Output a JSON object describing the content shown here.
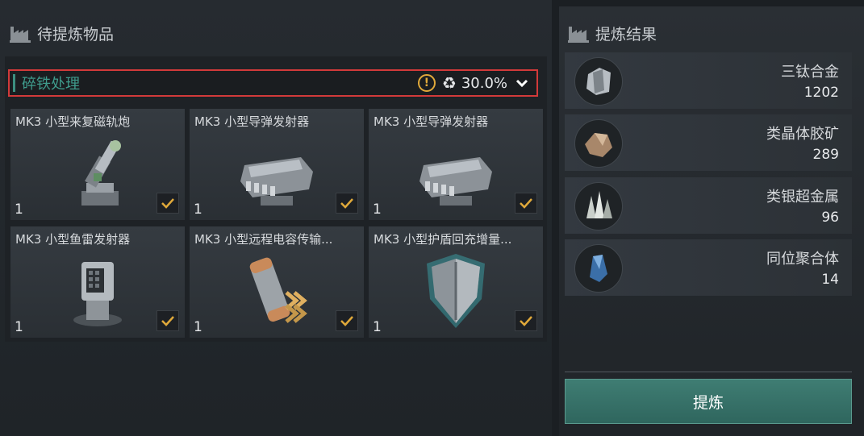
{
  "left_panel": {
    "title": "待提炼物品"
  },
  "right_panel": {
    "title": "提炼结果"
  },
  "filter": {
    "label": "碎铁处理",
    "percent": "30.0%"
  },
  "items": [
    {
      "name": "MK3 小型来复磁轨炮",
      "count": "1",
      "icon": "railgun-turret-icon"
    },
    {
      "name": "MK3 小型导弹发射器",
      "count": "1",
      "icon": "missile-launcher-icon"
    },
    {
      "name": "MK3 小型导弹发射器",
      "count": "1",
      "icon": "missile-launcher-icon"
    },
    {
      "name": "MK3 小型鱼雷发射器",
      "count": "1",
      "icon": "torpedo-launcher-icon"
    },
    {
      "name": "MK3 小型远程电容传输...",
      "count": "1",
      "icon": "capacitor-transmitter-icon"
    },
    {
      "name": "MK3 小型护盾回充增量...",
      "count": "1",
      "icon": "shield-booster-icon"
    }
  ],
  "results": [
    {
      "name": "三钛合金",
      "value": "1202",
      "icon": "tritanium-icon"
    },
    {
      "name": "类晶体胶矿",
      "value": "289",
      "icon": "crystal-ore-icon"
    },
    {
      "name": "类银超金属",
      "value": "96",
      "icon": "silver-metal-icon"
    },
    {
      "name": "同位聚合体",
      "value": "14",
      "icon": "isotope-icon"
    }
  ],
  "refine_button": {
    "label": "提炼"
  },
  "colors": {
    "accent": "#3f9b8c",
    "warning": "#e0a93a",
    "check": "#e0a93a",
    "highlight_border": "#d23a3a"
  }
}
